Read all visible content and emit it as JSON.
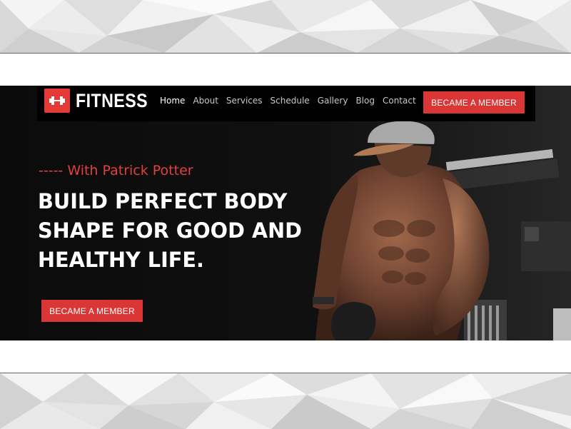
{
  "brand": {
    "name": "FITNESS",
    "accent": "#e33a35"
  },
  "nav": {
    "items": [
      {
        "label": "Home",
        "active": true
      },
      {
        "label": "About",
        "active": false
      },
      {
        "label": "Services",
        "active": false
      },
      {
        "label": "Schedule",
        "active": false
      },
      {
        "label": "Gallery",
        "active": false
      },
      {
        "label": "Blog",
        "active": false
      },
      {
        "label": "Contact",
        "active": false
      }
    ],
    "cta_label": "BECAME A MEMBER"
  },
  "hero": {
    "subtitle": "----- With Patrick Potter",
    "headline": "BUILD PERFECT BODY SHAPE FOR GOOD AND HEALTHY LIFE.",
    "cta_label": "BECAME A MEMBER",
    "image": "athlete-with-cap-photo"
  },
  "icons": {
    "logo": "dumbbell-icon"
  }
}
